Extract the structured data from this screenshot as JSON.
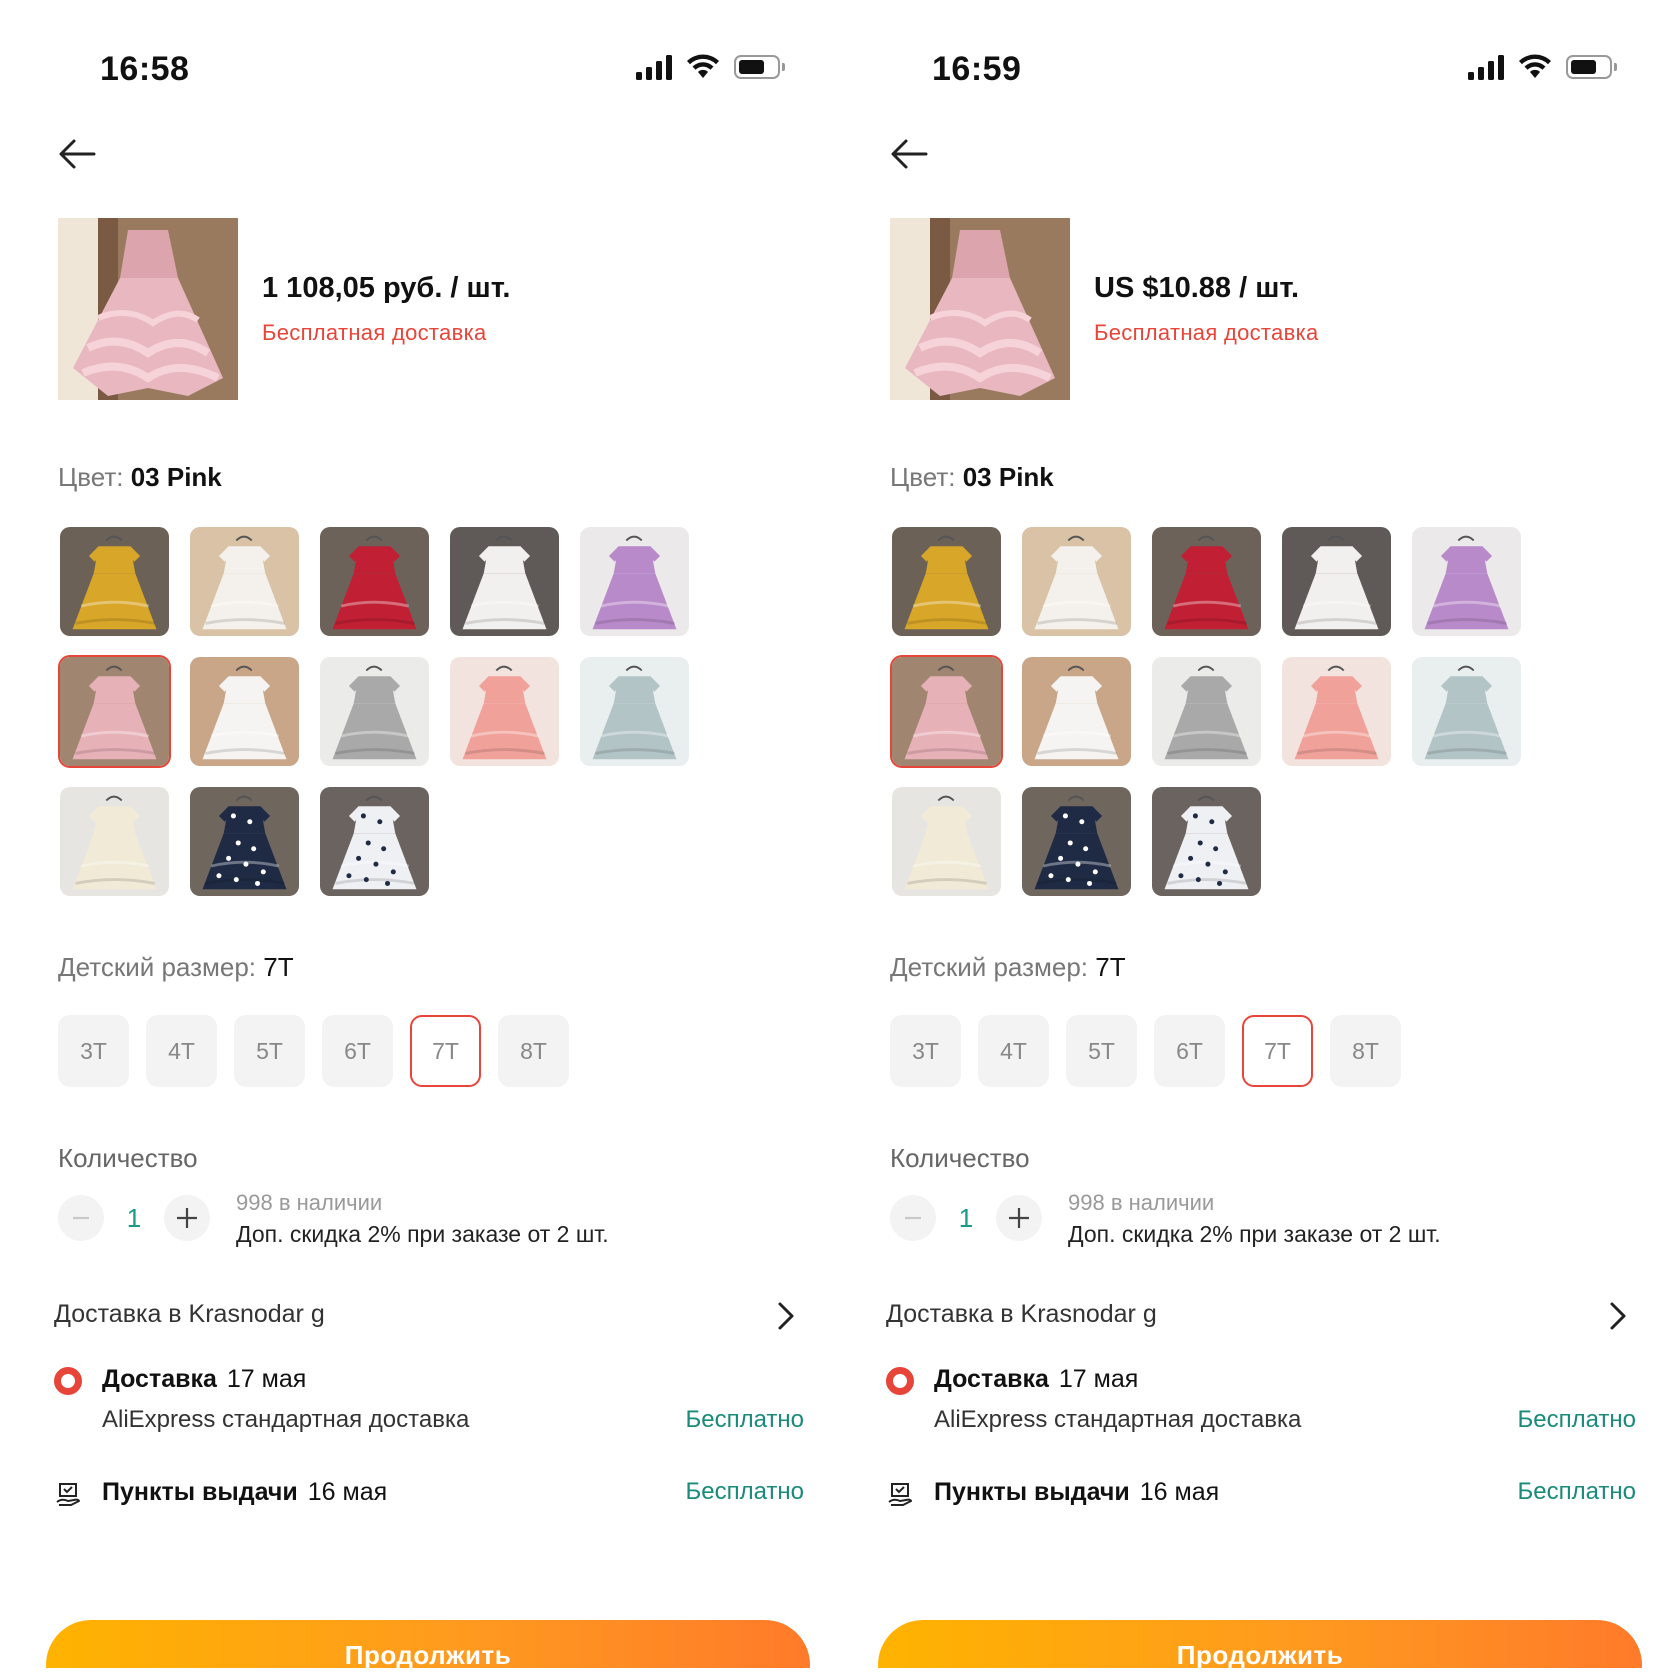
{
  "screens": [
    {
      "time": "16:58",
      "price": "1 108,05 руб. / шт.",
      "free_shipping": "Бесплатная доставка",
      "color_label": "Цвет:",
      "color_value": "03 Pink",
      "size_label": "Детский размер:",
      "size_value": "7T",
      "sizes": [
        "3T",
        "4T",
        "5T",
        "6T",
        "7T",
        "8T"
      ],
      "qty_label": "Количество",
      "qty_value": "1",
      "stock": "998 в наличии",
      "discount": "Доп. скидка 2% при заказе от 2 шт.",
      "delivery_to": "Доставка в Krasnodar g",
      "option1_title": "Доставка",
      "option1_date": "17 мая",
      "option1_sub": "AliExpress стандартная доставка",
      "option1_price": "Бесплатно",
      "option2_title": "Пункты выдачи",
      "option2_date": "16 мая",
      "option2_price": "Бесплатно",
      "continue": "Продолжить"
    },
    {
      "time": "16:59",
      "price": "US $10.88 / шт.",
      "free_shipping": "Бесплатная доставка",
      "color_label": "Цвет:",
      "color_value": "03 Pink",
      "size_label": "Детский размер:",
      "size_value": "7T",
      "sizes": [
        "3T",
        "4T",
        "5T",
        "6T",
        "7T",
        "8T"
      ],
      "qty_label": "Количество",
      "qty_value": "1",
      "stock": "998 в наличии",
      "discount": "Доп. скидка 2% при заказе от 2 шт.",
      "delivery_to": "Доставка в Krasnodar g",
      "option1_title": "Доставка",
      "option1_date": "17 мая",
      "option1_sub": "AliExpress стандартная доставка",
      "option1_price": "Бесплатно",
      "option2_title": "Пункты выдачи",
      "option2_date": "16 мая",
      "option2_price": "Бесплатно",
      "continue": "Продолжить"
    }
  ],
  "swatch_colors": [
    {
      "name": "yellow",
      "dress": "#d8a628",
      "bg": "#6b6157"
    },
    {
      "name": "white",
      "dress": "#f4f1ec",
      "bg": "#d9c2a5"
    },
    {
      "name": "red",
      "dress": "#c01f34",
      "bg": "#6d625a"
    },
    {
      "name": "white-lace",
      "dress": "#f2f0ee",
      "bg": "#5f5a57"
    },
    {
      "name": "purple",
      "dress": "#b98ac9",
      "bg": "#ece9eb"
    },
    {
      "name": "pink",
      "dress": "#e7b1b8",
      "bg": "#a08670"
    },
    {
      "name": "white-tiered",
      "dress": "#f6f4f2",
      "bg": "#c9a688"
    },
    {
      "name": "grey",
      "dress": "#a9a9aa",
      "bg": "#ebebea"
    },
    {
      "name": "coral",
      "dress": "#f0a29a",
      "bg": "#f3e3de"
    },
    {
      "name": "light-blue",
      "dress": "#b3c4c6",
      "bg": "#e9eeee"
    },
    {
      "name": "cream",
      "dress": "#f1ead7",
      "bg": "#e7e5e2"
    },
    {
      "name": "navy-polka",
      "dress": "#1f2b45",
      "bg": "#6f665d"
    },
    {
      "name": "white-navy-polka",
      "dress": "#eef0f4",
      "bg": "#6a6360"
    }
  ],
  "selected_swatch": 5,
  "accent_color": "#e8453a",
  "free_color": "#1a8a7a"
}
